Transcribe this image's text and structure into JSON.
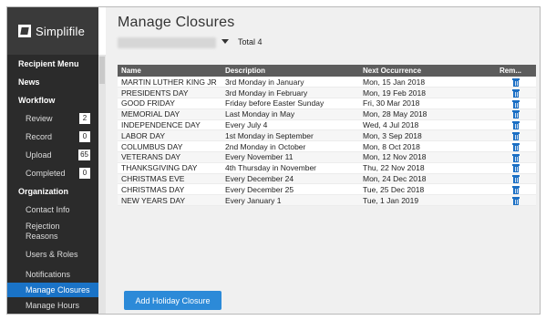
{
  "brand": {
    "name": "Simplifile"
  },
  "sidebar": {
    "sections": [
      {
        "label": "Recipient Menu"
      },
      {
        "label": "News"
      },
      {
        "label": "Workflow"
      },
      {
        "label": "Organization"
      }
    ],
    "workflow_items": [
      {
        "label": "Review",
        "count": "2"
      },
      {
        "label": "Record",
        "count": "0"
      },
      {
        "label": "Upload",
        "count": "65"
      },
      {
        "label": "Completed",
        "count": "0"
      }
    ],
    "org_items": [
      {
        "label": "Contact Info"
      },
      {
        "label": "Rejection Reasons"
      },
      {
        "label": "Users & Roles"
      },
      {
        "label": "Notifications"
      },
      {
        "label": "Manage Closures"
      },
      {
        "label": "Manage Hours"
      }
    ]
  },
  "main": {
    "title": "Manage Closures",
    "total_label": "Total 4",
    "columns": [
      "Name",
      "Description",
      "Next Occurrence",
      "Rem..."
    ],
    "rows": [
      {
        "name": "MARTIN LUTHER KING JR",
        "description": "3rd Monday in January",
        "next": "Mon, 15 Jan 2018"
      },
      {
        "name": "PRESIDENTS DAY",
        "description": "3rd Monday in February",
        "next": "Mon, 19 Feb 2018"
      },
      {
        "name": "GOOD FRIDAY",
        "description": "Friday before Easter Sunday",
        "next": "Fri, 30 Mar 2018"
      },
      {
        "name": "MEMORIAL DAY",
        "description": "Last Monday in May",
        "next": "Mon, 28 May 2018"
      },
      {
        "name": "INDEPENDENCE DAY",
        "description": "Every July 4",
        "next": "Wed, 4 Jul 2018"
      },
      {
        "name": "LABOR DAY",
        "description": "1st Monday in September",
        "next": "Mon, 3 Sep 2018"
      },
      {
        "name": "COLUMBUS DAY",
        "description": "2nd Monday in October",
        "next": "Mon, 8 Oct 2018"
      },
      {
        "name": "VETERANS DAY",
        "description": "Every November 11",
        "next": "Mon, 12 Nov 2018"
      },
      {
        "name": "THANKSGIVING DAY",
        "description": "4th Thursday in November",
        "next": "Thu, 22 Nov 2018"
      },
      {
        "name": "CHRISTMAS EVE",
        "description": "Every December 24",
        "next": "Mon, 24 Dec 2018"
      },
      {
        "name": "CHRISTMAS DAY",
        "description": "Every December 25",
        "next": "Tue, 25 Dec 2018"
      },
      {
        "name": "NEW YEARS DAY",
        "description": "Every January 1",
        "next": "Tue, 1 Jan 2019"
      }
    ],
    "add_button_label": "Add Holiday Closure"
  },
  "colors": {
    "accent": "#2c8ad8",
    "sidebar_bg": "#2b2b2b",
    "header_bg": "#5c5c5c"
  },
  "icons": {
    "remove": "trash-icon",
    "dropdown": "chevron-down-icon",
    "logo": "simplifile-logo-icon"
  }
}
